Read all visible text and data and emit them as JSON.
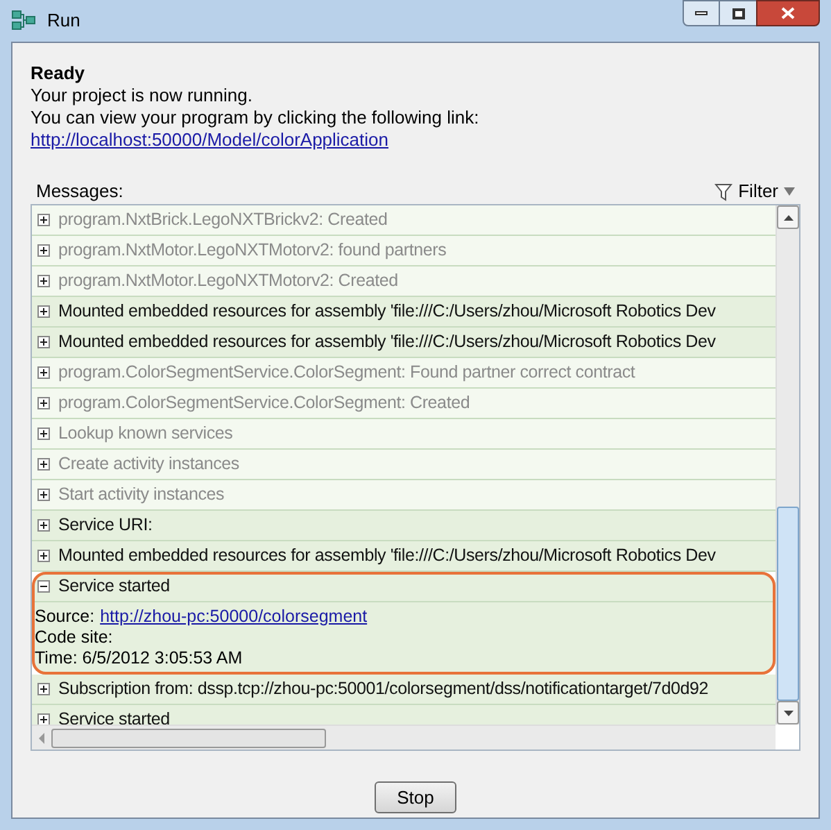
{
  "window": {
    "title": "Run"
  },
  "status": {
    "heading": "Ready",
    "lines": [
      "Your project is now running.",
      "You can view your program by clicking the following link:"
    ],
    "link": "http://localhost:50000/Model/colorApplication"
  },
  "messages": {
    "label": "Messages:",
    "filter": "Filter",
    "rows": [
      {
        "text": "program.NxtBrick.LegoNXTBrickv2: Created",
        "kind": "info",
        "expanded": false,
        "highlighted": false
      },
      {
        "text": "program.NxtMotor.LegoNXTMotorv2: found partners",
        "kind": "info",
        "expanded": false,
        "highlighted": false
      },
      {
        "text": "program.NxtMotor.LegoNXTMotorv2: Created",
        "kind": "info",
        "expanded": false,
        "highlighted": false
      },
      {
        "text": "Mounted embedded resources for assembly 'file:///C:/Users/zhou/Microsoft Robotics Dev",
        "kind": "important",
        "expanded": false,
        "highlighted": false
      },
      {
        "text": "Mounted embedded resources for assembly 'file:///C:/Users/zhou/Microsoft Robotics Dev",
        "kind": "important",
        "expanded": false,
        "highlighted": false
      },
      {
        "text": "program.ColorSegmentService.ColorSegment: Found partner correct contract",
        "kind": "info",
        "expanded": false,
        "highlighted": false
      },
      {
        "text": "program.ColorSegmentService.ColorSegment: Created",
        "kind": "info",
        "expanded": false,
        "highlighted": false
      },
      {
        "text": "Lookup known services",
        "kind": "info",
        "expanded": false,
        "highlighted": false
      },
      {
        "text": "Create activity instances",
        "kind": "info",
        "expanded": false,
        "highlighted": false
      },
      {
        "text": "Start activity instances",
        "kind": "info",
        "expanded": false,
        "highlighted": false
      },
      {
        "text": "Service URI:",
        "kind": "important",
        "expanded": false,
        "highlighted": false
      },
      {
        "text": "Mounted embedded resources for assembly 'file:///C:/Users/zhou/Microsoft Robotics Dev",
        "kind": "important",
        "expanded": false,
        "highlighted": false
      },
      {
        "text": "Service started",
        "kind": "important",
        "expanded": true,
        "highlighted": true,
        "details": [
          {
            "label": "Source:",
            "link": "http://zhou-pc:50000/colorsegment"
          },
          {
            "label": "Code site:"
          },
          {
            "label": "Time: 6/5/2012 3:05:53 AM"
          }
        ]
      },
      {
        "text": "Subscription from: dssp.tcp://zhou-pc:50001/colorsegment/dss/notificationtarget/7d0d92",
        "kind": "important",
        "expanded": false,
        "highlighted": false
      },
      {
        "text": "Service started",
        "kind": "important",
        "expanded": false,
        "highlighted": false
      }
    ]
  },
  "buttons": {
    "stop": "Stop"
  }
}
